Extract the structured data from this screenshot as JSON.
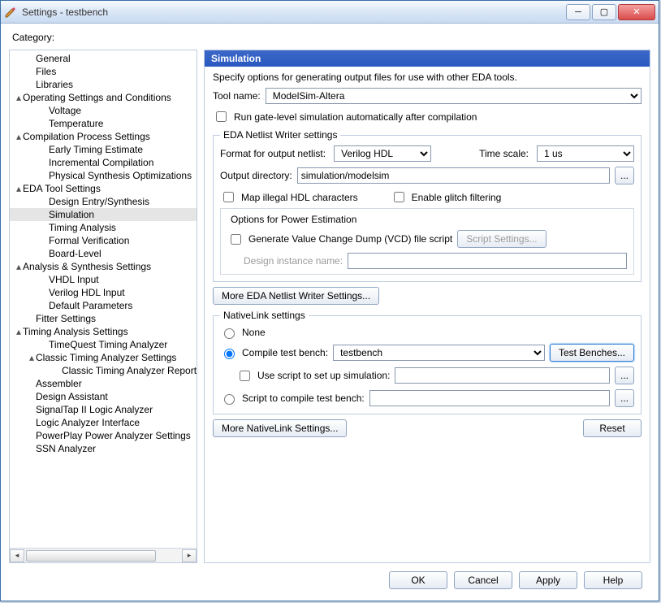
{
  "window": {
    "title": "Settings - testbench"
  },
  "category_label": "Category:",
  "tree": [
    {
      "indent": 1,
      "exp": "",
      "label": "General"
    },
    {
      "indent": 1,
      "exp": "",
      "label": "Files"
    },
    {
      "indent": 1,
      "exp": "",
      "label": "Libraries"
    },
    {
      "indent": 0,
      "exp": "▴",
      "label": "Operating Settings and Conditions"
    },
    {
      "indent": 2,
      "exp": "",
      "label": "Voltage"
    },
    {
      "indent": 2,
      "exp": "",
      "label": "Temperature"
    },
    {
      "indent": 0,
      "exp": "▴",
      "label": "Compilation Process Settings"
    },
    {
      "indent": 2,
      "exp": "",
      "label": "Early Timing Estimate"
    },
    {
      "indent": 2,
      "exp": "",
      "label": "Incremental Compilation"
    },
    {
      "indent": 2,
      "exp": "",
      "label": "Physical Synthesis Optimizations"
    },
    {
      "indent": 0,
      "exp": "▴",
      "label": "EDA Tool Settings"
    },
    {
      "indent": 2,
      "exp": "",
      "label": "Design Entry/Synthesis"
    },
    {
      "indent": 2,
      "exp": "",
      "label": "Simulation",
      "selected": true
    },
    {
      "indent": 2,
      "exp": "",
      "label": "Timing Analysis"
    },
    {
      "indent": 2,
      "exp": "",
      "label": "Formal Verification"
    },
    {
      "indent": 2,
      "exp": "",
      "label": "Board-Level"
    },
    {
      "indent": 0,
      "exp": "▴",
      "label": "Analysis & Synthesis Settings"
    },
    {
      "indent": 2,
      "exp": "",
      "label": "VHDL Input"
    },
    {
      "indent": 2,
      "exp": "",
      "label": "Verilog HDL Input"
    },
    {
      "indent": 2,
      "exp": "",
      "label": "Default Parameters"
    },
    {
      "indent": 1,
      "exp": "",
      "label": "Fitter Settings"
    },
    {
      "indent": 0,
      "exp": "▴",
      "label": "Timing Analysis Settings"
    },
    {
      "indent": 2,
      "exp": "",
      "label": "TimeQuest Timing Analyzer"
    },
    {
      "indent": 1,
      "exp": "▴",
      "label": "Classic Timing Analyzer Settings"
    },
    {
      "indent": 3,
      "exp": "",
      "label": "Classic Timing Analyzer Reporting"
    },
    {
      "indent": 1,
      "exp": "",
      "label": "Assembler"
    },
    {
      "indent": 1,
      "exp": "",
      "label": "Design Assistant"
    },
    {
      "indent": 1,
      "exp": "",
      "label": "SignalTap II Logic Analyzer"
    },
    {
      "indent": 1,
      "exp": "",
      "label": "Logic Analyzer Interface"
    },
    {
      "indent": 1,
      "exp": "",
      "label": "PowerPlay Power Analyzer Settings"
    },
    {
      "indent": 1,
      "exp": "",
      "label": "SSN Analyzer"
    }
  ],
  "main": {
    "header": "Simulation",
    "description": "Specify options for generating output files for use with other EDA tools.",
    "tool_name_label": "Tool name:",
    "tool_name": "ModelSim-Altera",
    "run_gate_level": "Run gate-level simulation automatically after compilation",
    "netlist_group": {
      "legend": "EDA Netlist Writer settings",
      "format_label": "Format for output netlist:",
      "format_value": "Verilog HDL",
      "timescale_label": "Time scale:",
      "timescale_value": "1 us",
      "outdir_label": "Output directory:",
      "outdir_value": "simulation/modelsim",
      "browse": "...",
      "map_illegal": "Map illegal HDL characters",
      "enable_glitch": "Enable glitch filtering",
      "power_group_title": "Options for Power Estimation",
      "gen_vcd": "Generate Value Change Dump (VCD) file script",
      "script_settings": "Script Settings...",
      "design_instance_label": "Design instance name:"
    },
    "more_netlist": "More EDA Netlist Writer Settings...",
    "nativelink": {
      "legend": "NativeLink settings",
      "none": "None",
      "compile_tb": "Compile test bench:",
      "tb_value": "testbench",
      "test_benches_btn": "Test Benches...",
      "use_script": "Use script to set up simulation:",
      "script_compile": "Script to compile test bench:",
      "browse": "..."
    },
    "more_nativelink": "More NativeLink Settings...",
    "reset": "Reset"
  },
  "footer": {
    "ok": "OK",
    "cancel": "Cancel",
    "apply": "Apply",
    "help": "Help"
  }
}
